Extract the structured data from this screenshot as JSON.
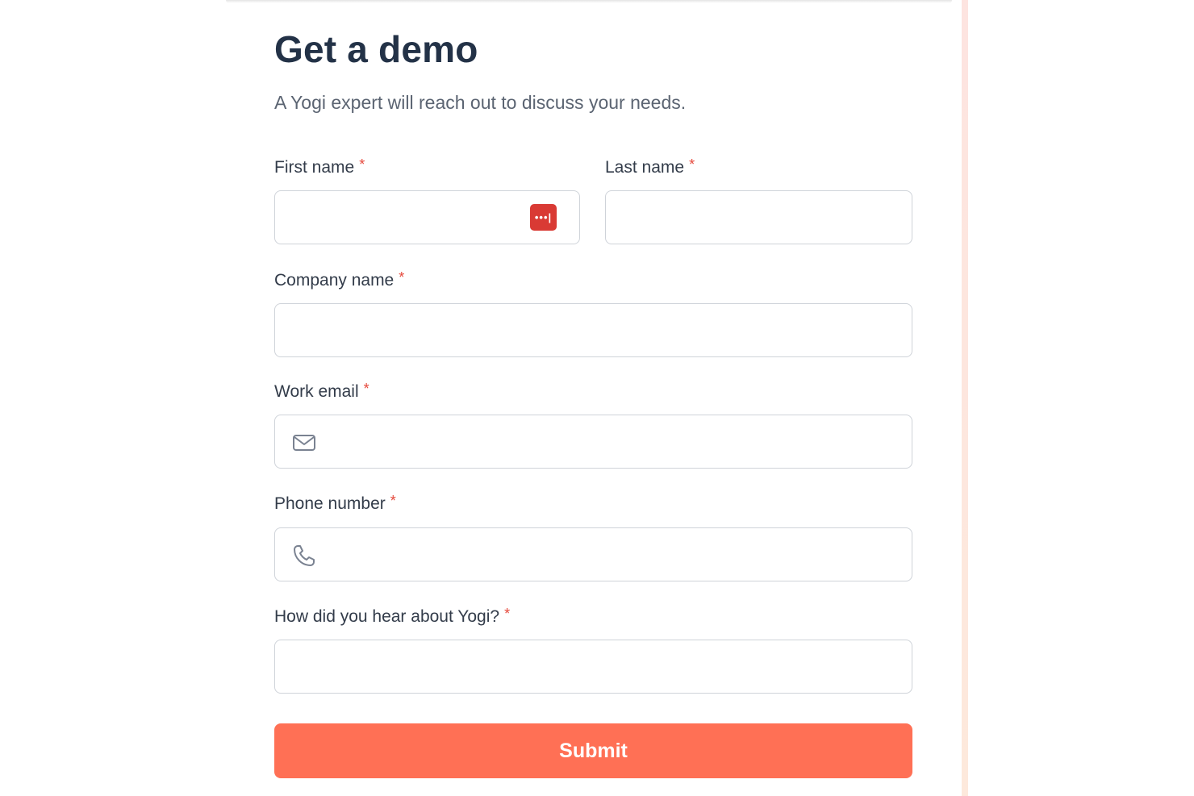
{
  "form": {
    "title": "Get a demo",
    "subtitle": "A Yogi expert will reach out to discuss your needs.",
    "required_marker": "*",
    "fields": {
      "first_name": {
        "label": "First name",
        "value": ""
      },
      "last_name": {
        "label": "Last name",
        "value": ""
      },
      "company_name": {
        "label": "Company name",
        "value": ""
      },
      "work_email": {
        "label": "Work email",
        "value": "",
        "icon": "mail-icon"
      },
      "phone_number": {
        "label": "Phone number",
        "value": "",
        "icon": "phone-icon"
      },
      "referral_source": {
        "label": "How did you hear about Yogi?",
        "value": ""
      }
    },
    "password_manager_icon": {
      "name": "password-manager-icon",
      "glyph": "•••|",
      "color": "#d93a34"
    },
    "submit_label": "Submit"
  },
  "colors": {
    "accent": "#ff7055",
    "title": "#233247",
    "required": "#e5483b"
  }
}
